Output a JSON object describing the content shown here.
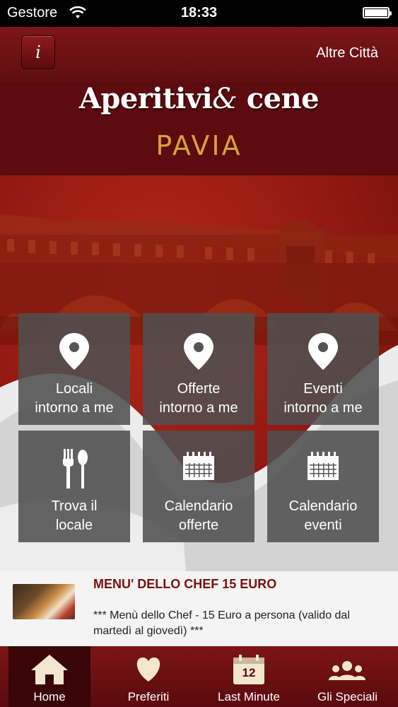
{
  "status_bar": {
    "carrier": "Gestore",
    "time": "18:33"
  },
  "header": {
    "info_label": "i",
    "other_cities": "Altre Città",
    "brand_part1": "Aperitivi",
    "brand_amp": "&",
    "brand_part2": "cene",
    "city": "PAVIA"
  },
  "tiles": [
    {
      "line1": "Locali",
      "line2": "intorno a me",
      "icon": "location-pin-icon"
    },
    {
      "line1": "Offerte",
      "line2": "intorno a me",
      "icon": "location-pin-icon"
    },
    {
      "line1": "Eventi",
      "line2": "intorno a me",
      "icon": "location-pin-icon"
    },
    {
      "line1": "Trova il",
      "line2": "locale",
      "icon": "fork-spoon-icon"
    },
    {
      "line1": "Calendario",
      "line2": "offerte",
      "icon": "calendar-icon"
    },
    {
      "line1": "Calendario",
      "line2": "eventi",
      "icon": "calendar-icon"
    }
  ],
  "news": {
    "title": "MENU' DELLO CHEF 15 EURO",
    "body": "*** Menù dello Chef - 15 Euro a persona (valido dal martedì al giovedì) ***"
  },
  "tabbar": {
    "home": "Home",
    "favorites": "Preferiti",
    "last_minute": "Last Minute",
    "last_minute_day": "12",
    "specials": "Gli Speciali"
  },
  "colors": {
    "brand_dark": "#5a0a0d",
    "accent_gold": "#d7a33a",
    "news_title": "#7a1010"
  }
}
